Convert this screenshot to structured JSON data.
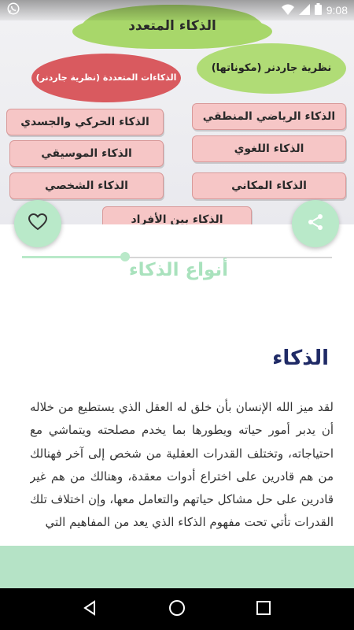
{
  "status_bar": {
    "time": "9:08",
    "icons": [
      "whatsapp-icon",
      "wifi-icon",
      "signal-icon",
      "battery-icon"
    ]
  },
  "header_image": {
    "main_title": "الذكاء المتعدد",
    "gardner_theory": "نظرية جاردنر (مكوناتها)",
    "multiple_intelligences": "الذكاءات المتعددة (نظرية جاردنر)",
    "boxes": [
      "الذكاء الرياضي المنطقي",
      "الذكاء الحركي والجسدي",
      "الذكاء اللغوي",
      "الذكاء الموسيقي",
      "الذكاء المكاني",
      "الذكاء الشخصي",
      "الذكاء بين الأفراد"
    ]
  },
  "section_title": "أنواع الذكاء",
  "article": {
    "heading": "الذكاء",
    "body": "لقد ميز الله الإنسان بأن خلق له العقل الذي يستطيع من خلاله أن يدبر أمور حياته ويطورها بما يخدم مصلحته ويتماشي مع احتياجاته، وتختلف القدرات العقلية من شخص إلى آخر فهنالك من هم قادرين على اختراع أدوات معقدة، وهنالك من هم غير قادرين على حل مشاكل حياتهم والتعامل معها، وإن اختلاف تلك القدرات تأتي تحت مفهوم الذكاء الذي يعد من المفاهيم التي"
  },
  "colors": {
    "accent": "#b9e9c9",
    "heading": "#1f2a66",
    "nav": "#000000"
  }
}
